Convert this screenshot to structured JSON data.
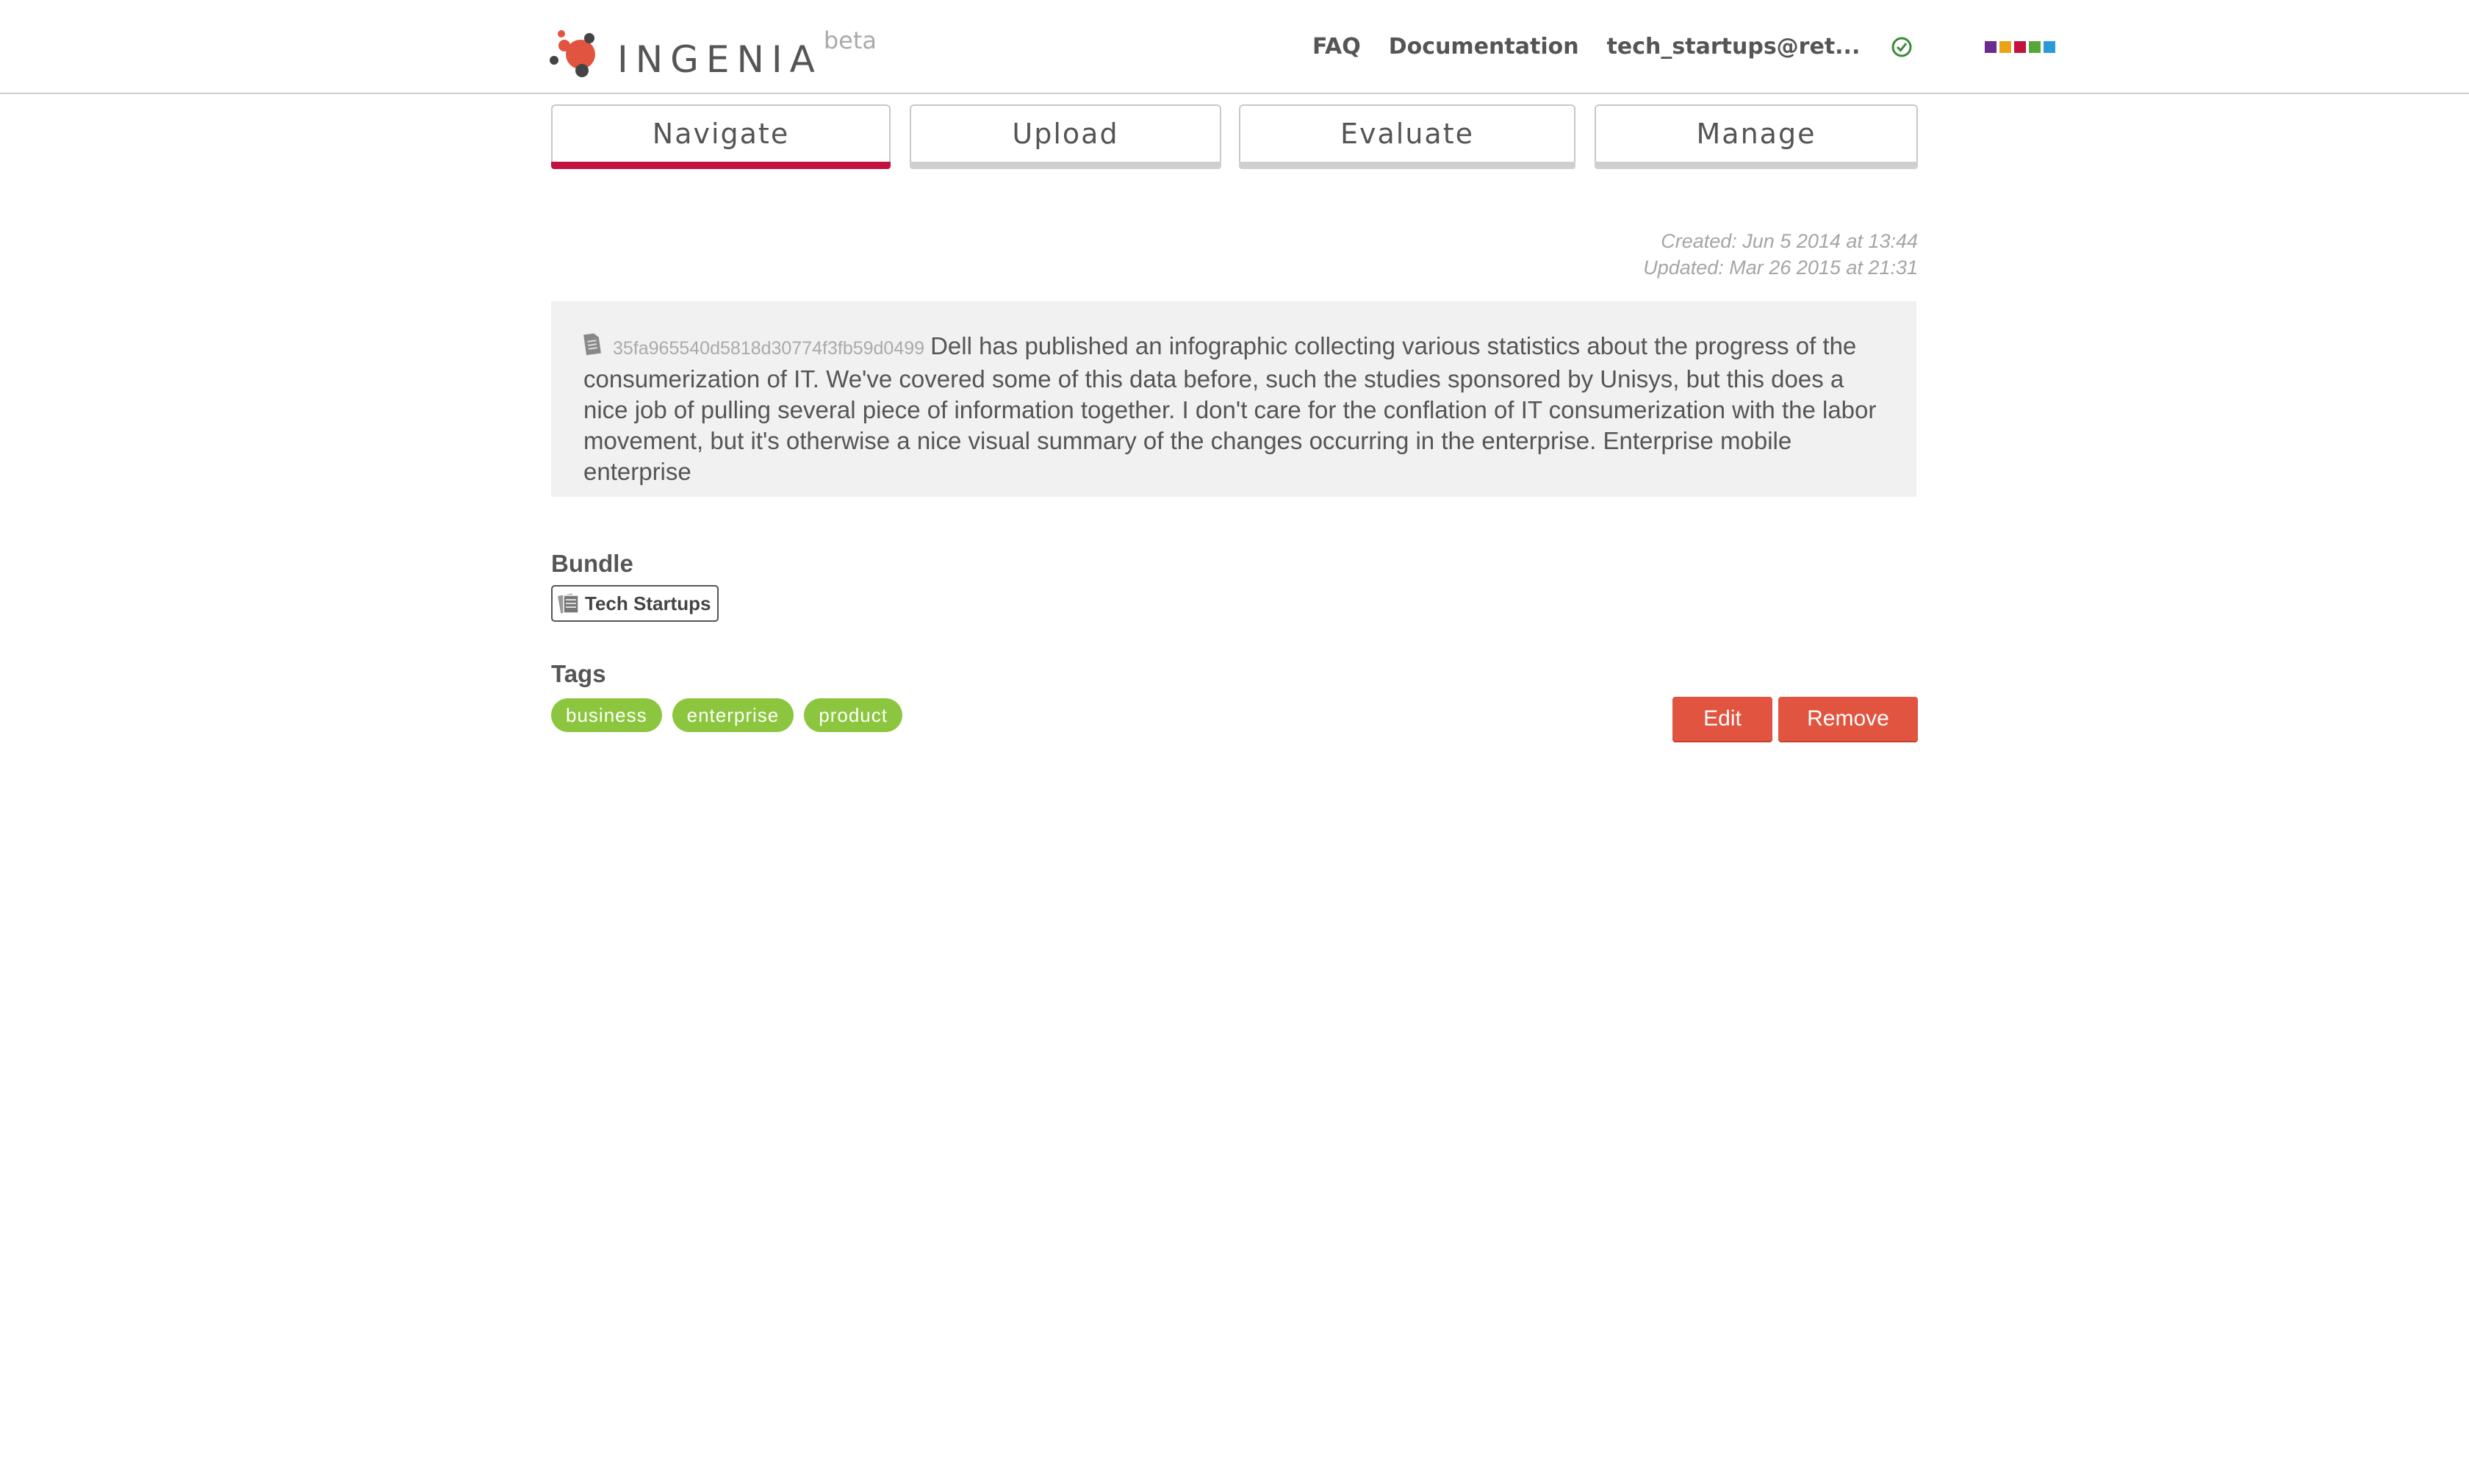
{
  "header": {
    "logo_text": "INGENIA",
    "logo_beta": "beta",
    "nav": [
      {
        "label": "FAQ"
      },
      {
        "label": "Documentation"
      },
      {
        "label": "tech_startups@ret..."
      }
    ],
    "status_icon": "check-circle-icon",
    "palette_colors": [
      "#6b2c8f",
      "#e8a317",
      "#c2123f",
      "#57a639",
      "#2a9bd6"
    ]
  },
  "tabs": [
    {
      "label": "Navigate",
      "active": true
    },
    {
      "label": "Upload",
      "active": false
    },
    {
      "label": "Evaluate",
      "active": false
    },
    {
      "label": "Manage",
      "active": false
    }
  ],
  "item": {
    "created": "Created: Jun 5 2014 at 13:44",
    "updated": "Updated: Mar 26 2015 at 21:31",
    "hash": "35fa965540d5818d30774f3fb59d0499",
    "text": "Dell has published an infographic collecting various statistics about the progress of the consumerization of IT. We've covered some of this data before, such the studies sponsored by Unisys, but this does a nice job of pulling several piece of information together. I don't care for the conflation of IT consumerization with the labor movement, but it's otherwise a nice visual summary of the changes occurring in the enterprise. Enterprise mobile enterprise"
  },
  "bundle": {
    "label": "Bundle",
    "name": "Tech Startups"
  },
  "tags": {
    "label": "Tags",
    "items": [
      "business",
      "enterprise",
      "product"
    ]
  },
  "actions": {
    "edit": "Edit",
    "remove": "Remove"
  },
  "colors": {
    "accent": "#c2123f",
    "tag_green": "#8cc63f",
    "button_red": "#e15440"
  }
}
